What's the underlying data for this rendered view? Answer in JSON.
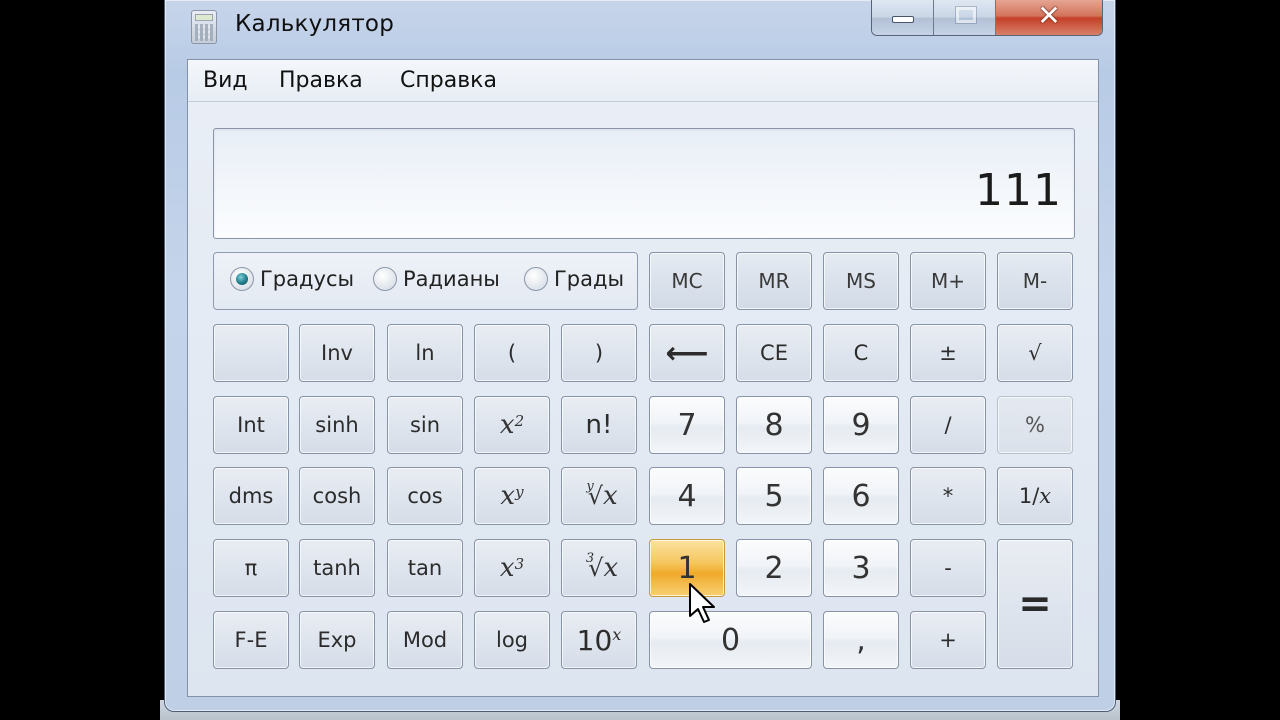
{
  "window": {
    "title": "Калькулятор",
    "icon": "calculator-icon",
    "caption_buttons": {
      "minimize": "minimize-icon",
      "maximize": "maximize-icon",
      "close": "✕"
    }
  },
  "menu": [
    {
      "label": "Вид"
    },
    {
      "label": "Правка"
    },
    {
      "label": "Справка"
    }
  ],
  "display": {
    "value": "111"
  },
  "angle_units": {
    "options": [
      {
        "label": "Градусы",
        "checked": true
      },
      {
        "label": "Радианы",
        "checked": false
      },
      {
        "label": "Грады",
        "checked": false
      }
    ]
  },
  "memory_buttons": [
    "MC",
    "MR",
    "MS",
    "M+",
    "M-"
  ],
  "buttons": {
    "row1": [
      "",
      "Inv",
      "ln",
      "(",
      ")",
      "⟵",
      "CE",
      "C",
      "±",
      "√"
    ],
    "row2": [
      "Int",
      "sinh",
      "sin",
      "x²",
      "n!",
      "7",
      "8",
      "9",
      "/",
      "%"
    ],
    "row3": [
      "dms",
      "cosh",
      "cos",
      "xʸ",
      "ʸ√x",
      "4",
      "5",
      "6",
      "*",
      "1/x"
    ],
    "row4": [
      "π",
      "tanh",
      "tan",
      "x³",
      "³√x",
      "1",
      "2",
      "3",
      "-",
      "="
    ],
    "row5": [
      "F-E",
      "Exp",
      "Mod",
      "log",
      "10ˣ",
      "0",
      ",",
      "+"
    ]
  },
  "math_labels": {
    "x2_base": "x",
    "x2_exp": "2",
    "xy_base": "x",
    "xy_exp": "y",
    "x3_base": "x",
    "x3_exp": "3",
    "yroot_idx": "y",
    "yroot_sym": "√",
    "yroot_x": "x",
    "root3_idx": "3",
    "root3_sym": "√",
    "root3_x": "x",
    "ten_base": "10",
    "ten_exp": "x",
    "inv_x_num": "1/",
    "inv_x_var": "x"
  },
  "state": {
    "hovered_button": "1"
  }
}
